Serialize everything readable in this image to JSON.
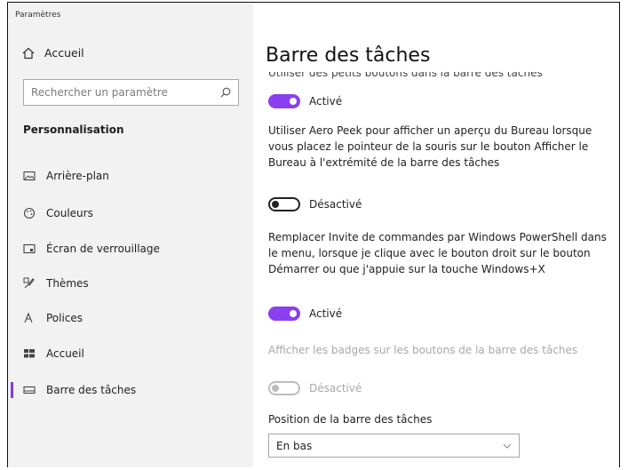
{
  "window": {
    "app_title": "Paramètres"
  },
  "sidebar": {
    "home_label": "Accueil",
    "search_placeholder": "Rechercher un paramètre",
    "section_title": "Personnalisation",
    "items": [
      {
        "label": "Arrière-plan",
        "icon": "picture-icon"
      },
      {
        "label": "Couleurs",
        "icon": "palette-icon"
      },
      {
        "label": "Écran de verrouillage",
        "icon": "lock-screen-icon"
      },
      {
        "label": "Thèmes",
        "icon": "brush-icon"
      },
      {
        "label": "Polices",
        "icon": "font-icon"
      },
      {
        "label": "Accueil",
        "icon": "start-grid-icon"
      },
      {
        "label": "Barre des tâches",
        "icon": "taskbar-icon",
        "selected": true
      }
    ]
  },
  "main": {
    "title": "Barre des tâches",
    "cut_text": "Utiliser des petits boutons dans la barre des tâches",
    "toggle_small": {
      "state": "Activé"
    },
    "aero_peek": {
      "text": "Utiliser Aero Peek pour afficher un aperçu du Bureau lorsque vous placez le pointeur de la souris sur le bouton Afficher le Bureau à l'extrémité de la barre des tâches",
      "state": "Désactivé"
    },
    "powershell": {
      "text": "Remplacer Invite de commandes par Windows PowerShell dans le menu, lorsque je clique avec le bouton droit sur le bouton Démarrer ou que j'appuie sur la touche Windows+X",
      "state": "Activé"
    },
    "badges": {
      "text": "Afficher les badges sur les boutons de la barre des tâches",
      "state": "Désactivé"
    },
    "position": {
      "label": "Position de la barre des tâches",
      "value": "En bas"
    }
  },
  "colors": {
    "accent": "#8a3ff0",
    "sidebar_bg": "#f2f2f2"
  }
}
